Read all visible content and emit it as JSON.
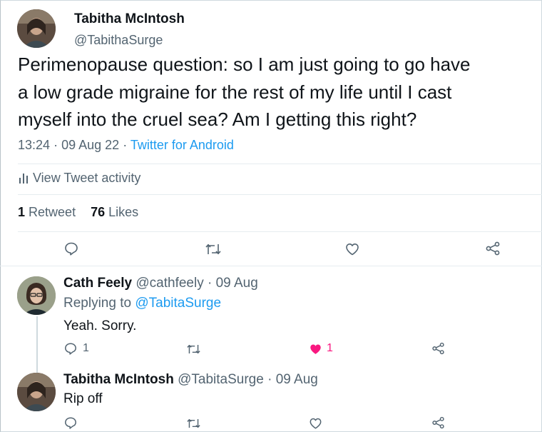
{
  "main_tweet": {
    "author_name": "Tabitha McIntosh",
    "handle": "@TabithaSurge",
    "text_line1": "Perimenopause question: so I am just going to go have",
    "text_line2": "a low grade migraine for the rest of my life until I cast",
    "text_line3": "myself into the cruel sea? Am I getting this right?",
    "time": "13:24",
    "date": "09 Aug 22",
    "source": "Twitter for Android",
    "activity_label": "View Tweet activity",
    "retweet_count": "1",
    "retweet_label": "Retweet",
    "likes_count": "76",
    "likes_label": "Likes"
  },
  "reply1": {
    "author_name": "Cath Feely",
    "handle": "@cathfeely",
    "date": "09 Aug",
    "replying_prefix": "Replying to",
    "replying_handle": "@TabitaSurge",
    "text": "Yeah. Sorry.",
    "reply_count": "1",
    "like_count": "1"
  },
  "reply2": {
    "author_name": "Tabitha McIntosh",
    "handle": "@TabitaSurge",
    "date": "09 Aug",
    "text": "Rip off"
  },
  "separator": "·",
  "colors": {
    "link": "#1d9bf0",
    "muted": "#536471",
    "like_pink": "#f91880",
    "divider": "#e6ecf0"
  }
}
